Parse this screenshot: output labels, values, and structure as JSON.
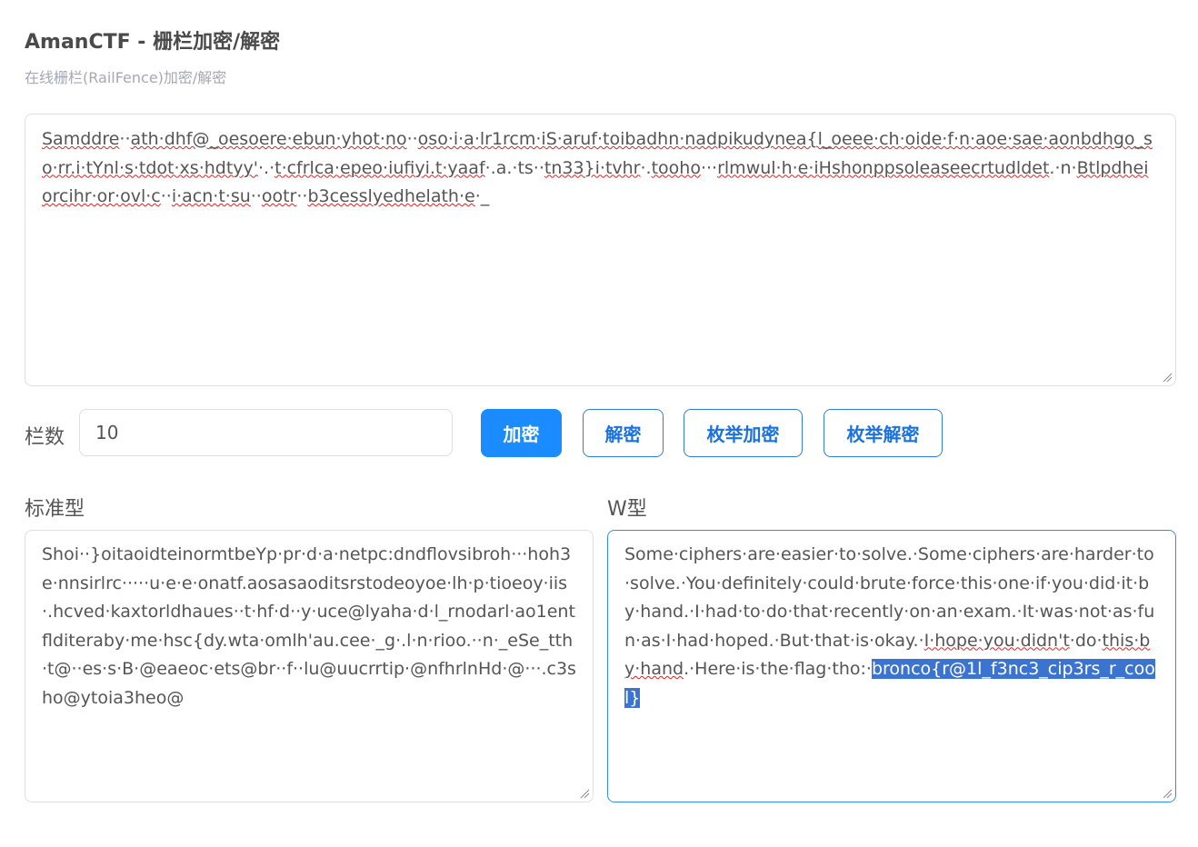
{
  "header": {
    "title": "AmanCTF - 栅栏加密/解密",
    "subtitle": "在线栅栏(RailFence)加密/解密"
  },
  "input": {
    "text_parts": [
      {
        "t": "Samddre",
        "s": 1
      },
      {
        "t": "··",
        "s": 0
      },
      {
        "t": "ath·dhf@_oesoere·ebun·yhot·no",
        "s": 1
      },
      {
        "t": "··",
        "s": 0
      },
      {
        "t": "oso·i·a·lr1rcm·iS·aruf·toibadhn·nadpikudynea{l_oeee·ch·oide·f·n·aoe·sae·aonbdhgo_so·rr.i·tYnl·s·tdot·xs·hdtyy'",
        "s": 1
      },
      {
        "t": "·.·",
        "s": 0
      },
      {
        "t": "t·cfrlca·epeo·iufiyi.t·yaaf",
        "s": 1
      },
      {
        "t": "·.a.·ts··",
        "s": 0
      },
      {
        "t": "tn33}i·tvhr",
        "s": 1
      },
      {
        "t": "·.",
        "s": 0
      },
      {
        "t": "tooho",
        "s": 1
      },
      {
        "t": "···",
        "s": 0
      },
      {
        "t": "rlmwul·h·e·iHshonppsoleaseecrtudldet",
        "s": 1
      },
      {
        "t": ".·n·",
        "s": 0
      },
      {
        "t": "Btlpdheiorcihr·or·ovl·c",
        "s": 1
      },
      {
        "t": "··",
        "s": 0
      },
      {
        "t": "i·acn·t·su",
        "s": 1
      },
      {
        "t": "··",
        "s": 0
      },
      {
        "t": "ootr",
        "s": 1
      },
      {
        "t": "··",
        "s": 0
      },
      {
        "t": "b3cesslyedhelath·e",
        "s": 1
      },
      {
        "t": "·_",
        "s": 0
      }
    ]
  },
  "controls": {
    "rails_label": "栏数",
    "rails_value": "10",
    "encrypt": "加密",
    "decrypt": "解密",
    "enum_encrypt": "枚举加密",
    "enum_decrypt": "枚举解密"
  },
  "standard": {
    "label": "标准型",
    "text": "Shoi··}oitaoidteinormtbeYp·pr·d·a·netpc:dndflovsibroh···hoh3e·nnsirlrc·····u·e·e·onatf.aosasaoditsrstodeoyoe·lh·p·tioeoy·iis·.hcved·kaxtorldhaues··t·hf·d··y·uce@lyaha·d·l_rnodarl·ao1entflditeraby·me·hsc{dy.wta·omlh'au.cee·_g·.l·n·rioo.··n·_eSe_tth·t@··es·s·B·@eaeoc·ets@br··f··lu@uucrrtip·@nfhrlnHd·@···.c3sho@ytoia3heo@"
  },
  "wtype": {
    "label": "W型",
    "parts": [
      {
        "t": "Some·ciphers·are·easier·to·solve.·Some·ciphers·are·harder·to·solve.·You·definitely·could·brute·force·this·one·if·you·did·it·by·hand.·I·had·to·do·that·recently·on·an·exam.·It·was·not·as·fun·as·I·had·hoped.·But·that·is·okay.·",
        "c": ""
      },
      {
        "t": "I·hope·you·didn't",
        "c": "spell"
      },
      {
        "t": "·do·",
        "c": ""
      },
      {
        "t": "this·by·hand",
        "c": "spell"
      },
      {
        "t": ".·Here·is·the·flag·tho:·",
        "c": ""
      },
      {
        "t": "bronco{r@1l_f3nc3_cip3rs_r_cool}",
        "c": "sel"
      }
    ]
  }
}
